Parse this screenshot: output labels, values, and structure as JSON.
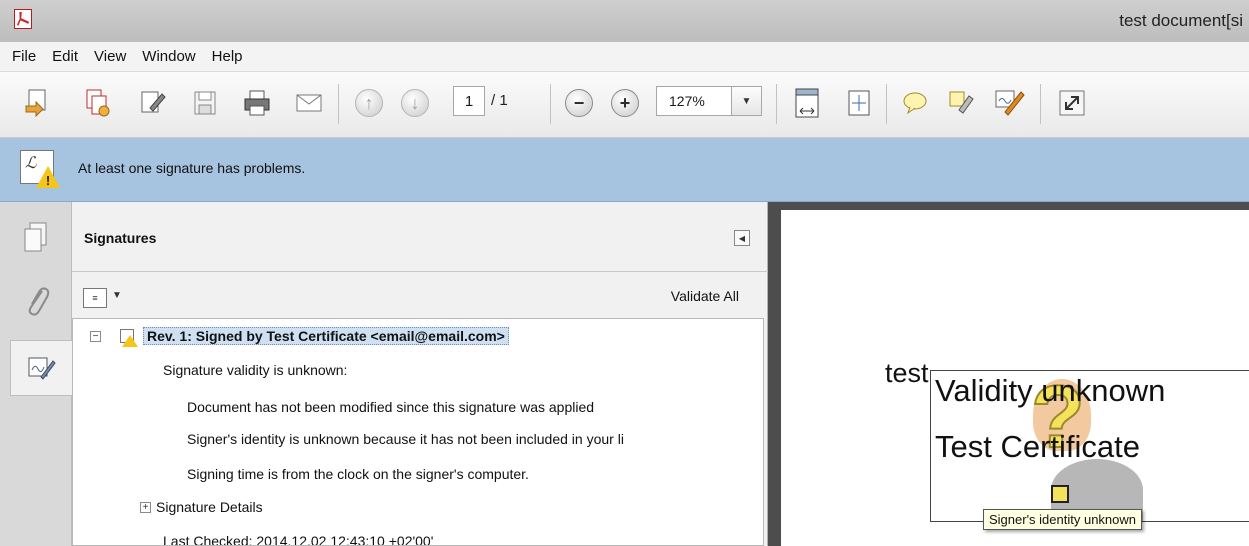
{
  "window": {
    "title": "test document[si"
  },
  "menu": [
    "File",
    "Edit",
    "View",
    "Window",
    "Help"
  ],
  "toolbar": {
    "icons": [
      "create-pdf-icon",
      "combine-files-icon",
      "edit-icon",
      "save-icon",
      "print-icon",
      "email-icon",
      "previous-page-icon",
      "next-page-icon",
      "zoom-out-icon",
      "zoom-in-icon",
      "fit-page-icon",
      "fit-width-icon",
      "comment-icon",
      "highlight-icon",
      "sign-icon",
      "fullscreen-icon"
    ],
    "page_current": "1",
    "page_total": "/ 1",
    "zoom": "127%"
  },
  "notification": {
    "message": "At least one signature has problems."
  },
  "signatures_panel": {
    "title": "Signatures",
    "validate_all": "Validate All",
    "revision": "Rev. 1: Signed by Test Certificate <email@email.com>",
    "validity": "Signature validity is unknown:",
    "details": [
      "Document has not been modified since this signature was applied",
      "Signer's identity is unknown because it has not been included in your li",
      "Signing time is from the clock on the signer's computer."
    ],
    "signature_details": "Signature Details",
    "last_checked": "Last Checked: 2014.12.02 12:43:10 +02'00'"
  },
  "document": {
    "body_text": "test",
    "signature_appearance": {
      "line1": "Validity unknown",
      "line2": "Test Certificate"
    },
    "tooltip": "Signer's identity unknown"
  },
  "colors": {
    "notification_bg": "#a6c3e0",
    "selection_bg": "#cfe0f3",
    "warning": "#f5c518"
  }
}
